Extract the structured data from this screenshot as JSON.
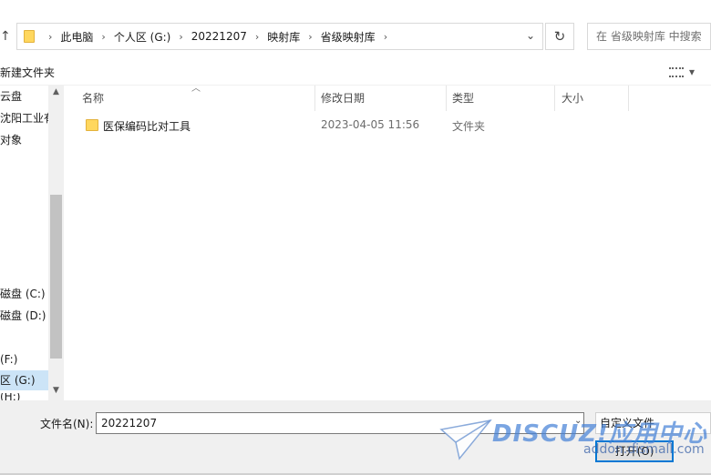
{
  "address_bar": {
    "up_icon": "arrow-up-icon",
    "breadcrumbs": [
      {
        "label": "此电脑"
      },
      {
        "label": "个人区 (G:)"
      },
      {
        "label": "20221207"
      },
      {
        "label": "映射库"
      },
      {
        "label": "省级映射库"
      }
    ],
    "refresh_icon": "refresh-icon",
    "search_placeholder": "在 省级映射库 中搜索"
  },
  "toolbar": {
    "new_folder_label": "新建文件夹",
    "view_icon": "view-options-icon"
  },
  "nav_pane": {
    "items": [
      {
        "label": "云盘",
        "selected": false
      },
      {
        "label": "沈阳工业有限",
        "selected": false
      },
      {
        "label": "对象",
        "selected": false
      },
      {
        "label": "磁盘 (C:)",
        "selected": false
      },
      {
        "label": "磁盘 (D:)",
        "selected": false
      },
      {
        "label": "(F:)",
        "selected": false
      },
      {
        "label": "区 (G:)",
        "selected": true
      },
      {
        "label": "(H:)",
        "selected": false
      }
    ]
  },
  "file_list": {
    "columns": [
      {
        "label": "名称"
      },
      {
        "label": "修改日期"
      },
      {
        "label": "类型"
      },
      {
        "label": "大小"
      }
    ],
    "rows": [
      {
        "name": "医保编码比对工具",
        "modified": "2023-04-05 11:56",
        "type": "文件夹",
        "size": ""
      }
    ]
  },
  "footer": {
    "filename_label": "文件名(N):",
    "filename_value": "20221207",
    "filter_label": "自定义文件",
    "open_label": "打开(O)"
  },
  "watermark": {
    "brand": "DISCUZ!应用中心",
    "url": "addon.dismall.com"
  },
  "colors": {
    "selection": "#cce4f7",
    "accent": "#0078d4",
    "folder": "#ffd75e"
  }
}
